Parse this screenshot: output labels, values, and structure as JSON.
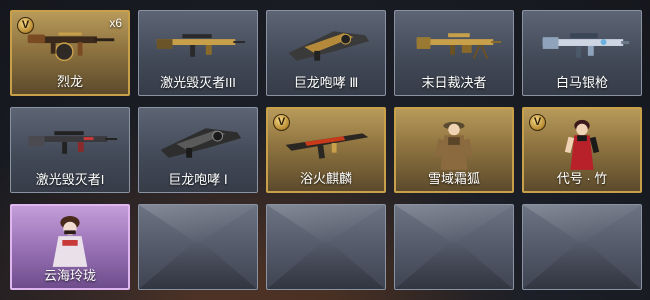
{
  "slots": [
    {
      "label": "烈龙",
      "badge": "V",
      "count": "x6"
    },
    {
      "label": "激光毁灭者III"
    },
    {
      "label": "巨龙咆哮 Ⅲ"
    },
    {
      "label": "末日裁决者"
    },
    {
      "label": "白马银枪"
    },
    {
      "label": "激光毁灭者I"
    },
    {
      "label": "巨龙咆哮 Ⅰ"
    },
    {
      "label": "浴火麒麟",
      "badge": "V"
    },
    {
      "label": "雪域霜狐"
    },
    {
      "label": "代号 · 竹",
      "badge": "V"
    },
    {
      "label": "云海玲珑"
    }
  ],
  "colors": {
    "gold_border": "#c9a04a",
    "purple_border": "#e0b6f0",
    "normal_border": "#8a93a3"
  },
  "icons": {
    "slot_0": "tommy-gun-icon",
    "slot_1": "laser-rifle-icon",
    "slot_2": "dragon-cannon-icon",
    "slot_3": "machine-gun-icon",
    "slot_4": "silver-rifle-icon",
    "slot_5": "laser-rifle-icon",
    "slot_6": "dragon-cannon-icon",
    "slot_7": "kirin-rifle-icon",
    "slot_8": "female-soldier-character",
    "slot_9": "female-red-dress-character",
    "slot_10": "female-pale-character"
  }
}
